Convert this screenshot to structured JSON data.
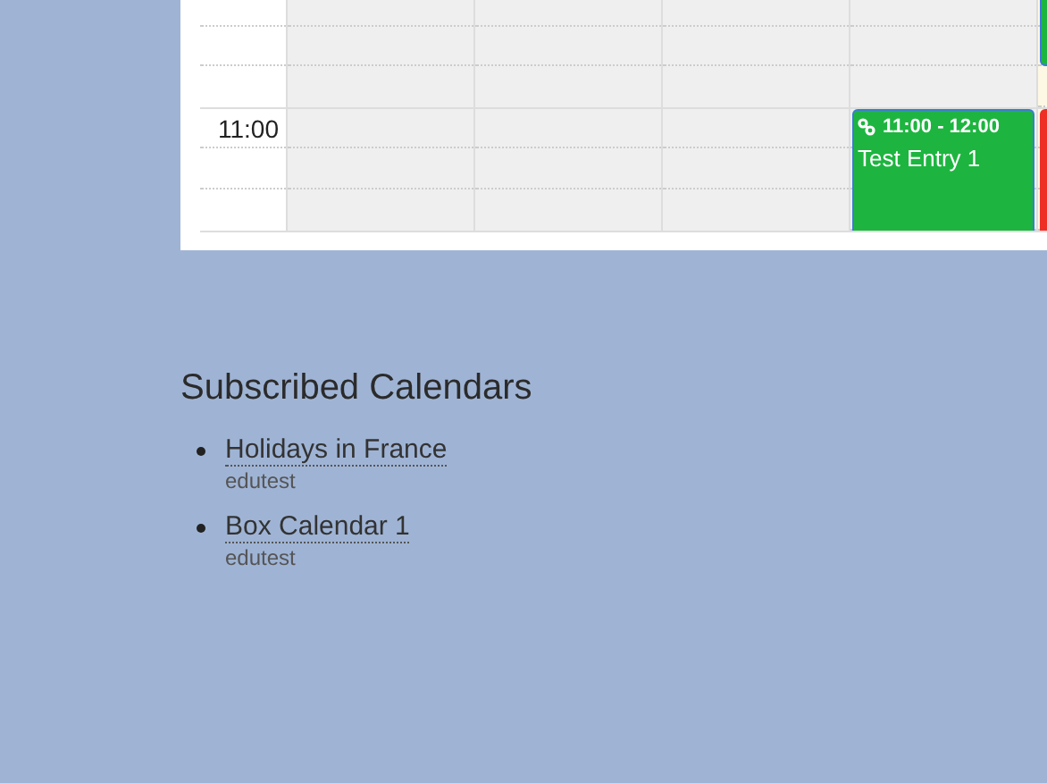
{
  "calendar": {
    "hour_rows": [
      {
        "kind": "partial"
      },
      {
        "kind": "full",
        "label": "11:00"
      }
    ],
    "days": [
      {
        "today": false
      },
      {
        "today": false
      },
      {
        "today": false
      },
      {
        "today": false,
        "events": [
          {
            "kind": "full",
            "time": "11:00 - 12:00",
            "title": "Test Entry 1",
            "color": "#1db53f"
          }
        ]
      },
      {
        "today": true,
        "events": [
          {
            "kind": "tail",
            "color": "#1db53f"
          },
          {
            "kind": "start",
            "color": "#ee2f26"
          }
        ]
      }
    ]
  },
  "subscribed": {
    "title": "Subscribed Calendars",
    "items": [
      {
        "name": "Holidays in France",
        "owner": "edutest"
      },
      {
        "name": "Box Calendar 1",
        "owner": "edutest"
      }
    ]
  }
}
